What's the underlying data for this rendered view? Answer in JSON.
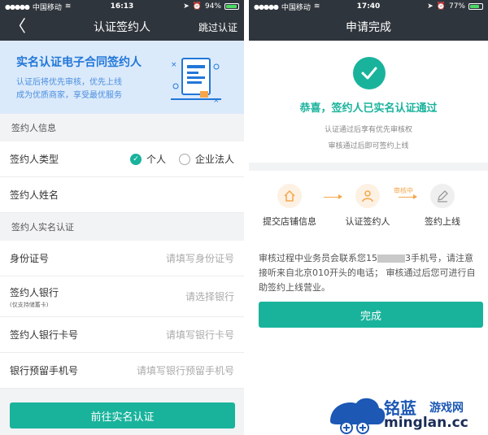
{
  "left_screen": {
    "status": {
      "carrier": "中国移动",
      "time": "16:13",
      "battery": "94%",
      "battery_level": 0.94
    },
    "nav": {
      "title": "认证签约人",
      "skip": "跳过认证"
    },
    "banner": {
      "title": "实名认证电子合同签约人",
      "line1": "认证后将优先审核，优先上线",
      "line2": "成为优质商家，享受最优服务"
    },
    "section1": {
      "header": "签约人信息",
      "type_label": "签约人类型",
      "option_personal": "个人",
      "option_corporate": "企业法人",
      "name_label": "签约人姓名"
    },
    "section2": {
      "header": "签约人实名认证",
      "id_label": "身份证号",
      "id_placeholder": "请填写身份证号",
      "bank_label": "签约人银行",
      "bank_note": "(仅支持储蓄卡)",
      "bank_placeholder": "请选择银行",
      "card_label": "签约人银行卡号",
      "card_placeholder": "请填写银行卡号",
      "phone_label": "银行预留手机号",
      "phone_placeholder": "请填写银行预留手机号"
    },
    "submit": "前往实名认证"
  },
  "right_screen": {
    "status": {
      "carrier": "中国移动",
      "time": "17:40",
      "battery": "77%",
      "battery_level": 0.77
    },
    "nav": {
      "title": "申请完成"
    },
    "success": {
      "title": "恭喜，签约人已实名认证通过",
      "line1": "认证通过后享有优先审核权",
      "line2": "审核通过后即可签约上线"
    },
    "steps": [
      {
        "label": "提交店铺信息"
      },
      {
        "label": "认证签约人"
      },
      {
        "label": "签约上线"
      }
    ],
    "arrow_label": "审核中",
    "info": {
      "part1": "审核过程中业务员会联系您15",
      "part2": "3手机号，请注意接听来自北京010开头的电话； 审核通过后您可进行自助签约上线营业。"
    },
    "done": "完成"
  },
  "watermark": {
    "name": "铭蓝",
    "sub": "游戏网",
    "url": "minglan.cc"
  },
  "colors": {
    "teal": "#19b39c",
    "dark_bar": "#2f353c",
    "banner_bg": "#dbeafb",
    "blue_text": "#2277d8",
    "orange": "#f5a64a"
  }
}
